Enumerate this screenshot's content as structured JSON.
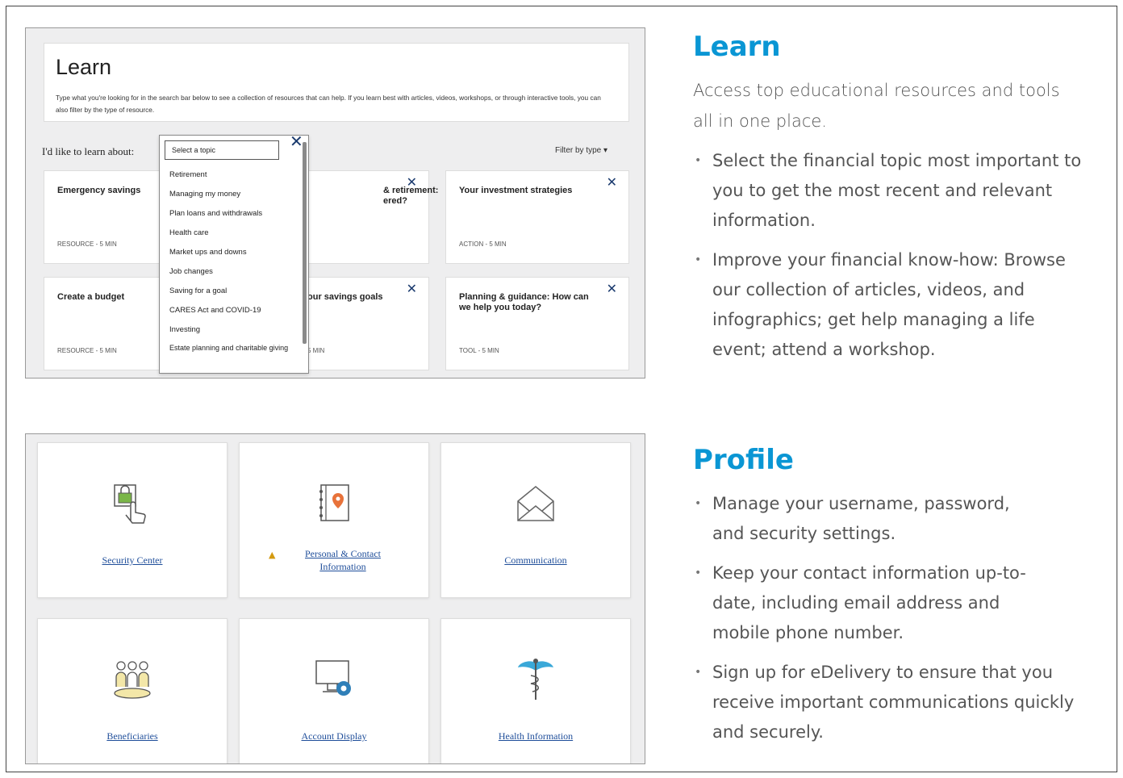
{
  "learn_screenshot": {
    "title": "Learn",
    "description": "Type what you're looking for in the search bar below to see a collection of resources that can help. If you learn best with articles, videos, workshops, or through interactive tools, you can also filter by the type of resource.",
    "prompt_label": "I'd like to learn about:",
    "topic_placeholder": "Select a topic",
    "filter_label": "Filter by type ▾",
    "topics": [
      "Retirement",
      "Managing my money",
      "Plan loans and withdrawals",
      "Health care",
      "Market ups and downs",
      "Job changes",
      "Saving for a goal",
      "CARES Act and COVID-19",
      "Investing",
      "Estate planning and charitable giving"
    ],
    "cards": [
      {
        "title": "Emergency savings",
        "meta": "RESOURCE - 5 MIN"
      },
      {
        "title": "& retirement:\nered?",
        "meta": ""
      },
      {
        "title": "Your investment strategies",
        "meta": "ACTION - 5 MIN"
      },
      {
        "title": "Create a budget",
        "meta": "RESOURCE - 5 MIN"
      },
      {
        "title": "our savings goals",
        "meta": "5 MIN"
      },
      {
        "title": "Planning & guidance: How can we help you today?",
        "meta": "TOOL - 5 MIN"
      }
    ]
  },
  "profile_screenshot": {
    "tiles": [
      {
        "label": "Security Center",
        "icon": "security-lock-icon"
      },
      {
        "label": "Personal & Contact Information",
        "icon": "address-book-icon"
      },
      {
        "label": "Communication",
        "icon": "envelope-icon"
      },
      {
        "label": "Beneficiaries",
        "icon": "people-icon"
      },
      {
        "label": "Account Display",
        "icon": "monitor-gear-icon"
      },
      {
        "label": "Health Information",
        "icon": "caduceus-icon"
      }
    ]
  },
  "learn_section": {
    "heading": "Learn",
    "lead": "Access top educational resources and tools all in one place.",
    "bullets": [
      "Select the financial topic most important to you to get the most recent and relevant information.",
      "Improve your financial know-how: Browse our collection of articles, videos, and infographics; get help managing a life event; attend a workshop."
    ]
  },
  "profile_section": {
    "heading": "Profile",
    "bullets": [
      "Manage your username, password, and security settings.",
      "Keep your contact information up-to-date, including email address and mobile phone number.",
      "Sign up for eDelivery to ensure that you receive important communications quickly and securely."
    ]
  },
  "colors": {
    "accent": "#0a96d4",
    "link": "#1f4e9a",
    "close": "#1a3a6e"
  }
}
